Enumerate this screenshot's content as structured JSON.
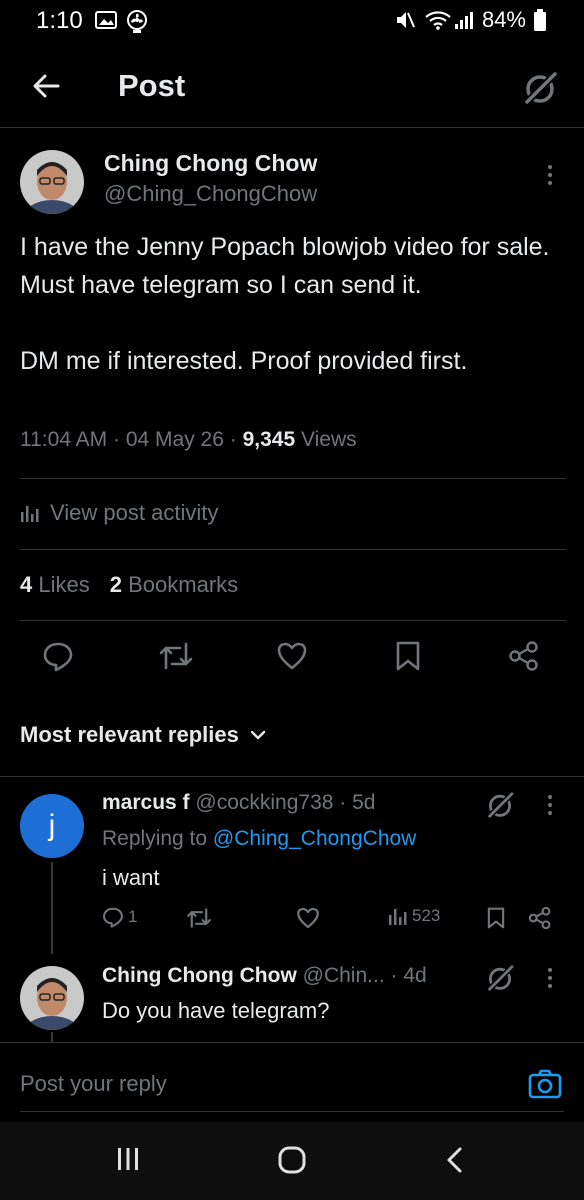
{
  "status_bar": {
    "time": "1:10",
    "battery": "84%"
  },
  "header": {
    "title": "Post"
  },
  "post": {
    "author_name": "Ching Chong Chow",
    "author_handle": "@Ching_ChongChow",
    "text": "I have the Jenny Popach blowjob video for sale. Must have telegram so I can send it.\n\nDM me if interested. Proof provided first.",
    "time": "11:04 AM",
    "date": "04 May 26",
    "views_count": "9,345",
    "views_label": "Views",
    "activity_label": "View post activity",
    "likes_count": "4",
    "likes_label": "Likes",
    "bookmarks_count": "2",
    "bookmarks_label": "Bookmarks"
  },
  "replies_filter": "Most relevant replies",
  "replies": [
    {
      "avatar_letter": "j",
      "name": "marcus f",
      "handle": "@cockking738",
      "age": "5d",
      "replying_prefix": "Replying to",
      "replying_to": "@Ching_ChongChow",
      "text": "i want",
      "reply_count": "1",
      "views": "523"
    },
    {
      "name": "Ching Chong Chow",
      "handle": "@Chin...",
      "age": "4d",
      "text": "Do you have telegram?"
    }
  ],
  "reply_box": {
    "placeholder": "Post your reply"
  },
  "colors": {
    "background": "#000000",
    "text": "#e7e9ea",
    "muted": "#71767b",
    "accent": "#1d9bf0",
    "divider": "#2f3336",
    "avatar_blue": "#1d6fd6"
  },
  "icons": [
    "back-arrow-icon",
    "grok-icon",
    "reply-icon",
    "repost-icon",
    "like-icon",
    "bookmark-icon",
    "share-icon",
    "stats-icon",
    "camera-icon"
  ]
}
